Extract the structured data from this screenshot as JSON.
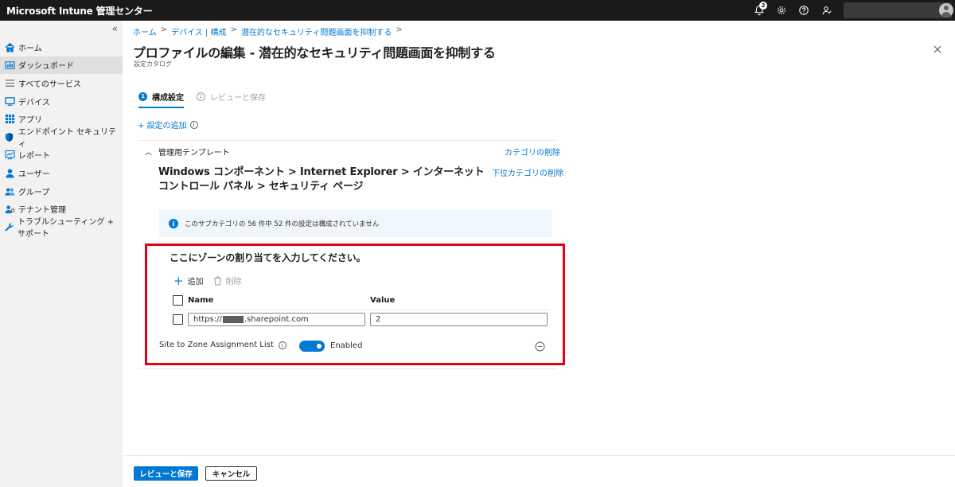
{
  "app": {
    "title": "Microsoft Intune 管理センター"
  },
  "topbar": {
    "notification_count": "2",
    "icons": [
      "bell-icon",
      "gear-icon",
      "help-icon",
      "feedback-icon"
    ]
  },
  "sidebar": {
    "collapse_glyph": "«",
    "items": [
      {
        "label": "ホーム",
        "icon": "home-icon"
      },
      {
        "label": "ダッシュボード",
        "icon": "dashboard-icon",
        "active": true
      },
      {
        "label": "すべてのサービス",
        "icon": "list-icon"
      },
      {
        "label": "デバイス",
        "icon": "device-icon"
      },
      {
        "label": "アプリ",
        "icon": "apps-grid-icon"
      },
      {
        "label": "エンドポイント セキュリティ",
        "icon": "shield-icon"
      },
      {
        "label": "レポート",
        "icon": "report-icon"
      },
      {
        "label": "ユーザー",
        "icon": "user-icon"
      },
      {
        "label": "グループ",
        "icon": "group-icon"
      },
      {
        "label": "テナント管理",
        "icon": "tenant-icon"
      },
      {
        "label": "トラブルシューティング + サポート",
        "icon": "wrench-icon"
      }
    ]
  },
  "breadcrumb": [
    "ホーム",
    "デバイス | 構成",
    "潜在的なセキュリティ問題画面を抑制する",
    ""
  ],
  "page": {
    "title": "プロファイルの編集 - 潜在的なセキュリティ問題画面を抑制する",
    "more": "···",
    "subtitle": "設定カタログ"
  },
  "steps": [
    {
      "number": "1",
      "label": "構成設定",
      "state": "current"
    },
    {
      "number": "2",
      "label": "レビューと保存",
      "state": "pending"
    }
  ],
  "add_setting": {
    "label": "+ 設定の追加"
  },
  "group": {
    "header": "管理用テンプレート",
    "delete_category": "カテゴリの削除",
    "delete_subcategory": "下位カテゴリの削除",
    "path": "Windows コンポーネント > Internet Explorer > インターネット コントロール パネル > セキュリティ ページ",
    "info": "このサブカテゴリの 56 件中 52 件の設定は構成されていません"
  },
  "zone": {
    "title": "ここにゾーンの割り当てを入力してください。",
    "add_label": "追加",
    "delete_label": "削除",
    "columns": {
      "name": "Name",
      "value": "Value"
    },
    "rows": [
      {
        "name_prefix": "https://",
        "name_suffix": ".sharepoint.com",
        "value": "2"
      }
    ]
  },
  "setting": {
    "label": "Site to Zone Assignment List",
    "toggle_state": "Enabled"
  },
  "footer": {
    "primary": "レビューと保存",
    "secondary": "キャンセル"
  },
  "colors": {
    "accent": "#0078d4",
    "highlight": "#e60012",
    "topbar": "#1b1a19"
  }
}
